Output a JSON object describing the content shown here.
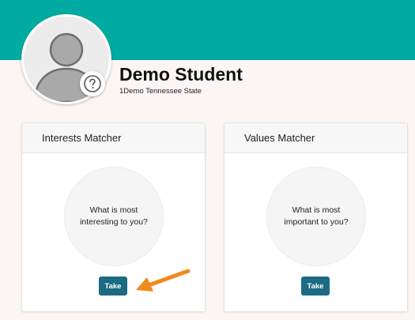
{
  "header": {
    "banner_color": "#00aca1"
  },
  "profile": {
    "name": "Demo Student",
    "subtitle": "1Demo Tennessee State",
    "avatar_icon": "user-silhouette-icon",
    "help_icon": "question-mark-icon"
  },
  "cards": [
    {
      "title": "Interests Matcher",
      "prompt": "What is most interesting to you?",
      "button_label": "Take"
    },
    {
      "title": "Values Matcher",
      "prompt": "What is most important to you?",
      "button_label": "Take"
    }
  ],
  "annotation": {
    "arrow_color": "#f08a1c",
    "arrow_icon": "arrow-left-icon"
  },
  "colors": {
    "background": "#fbf6f3",
    "button": "#1c6b82",
    "accent": "#00aca1"
  }
}
